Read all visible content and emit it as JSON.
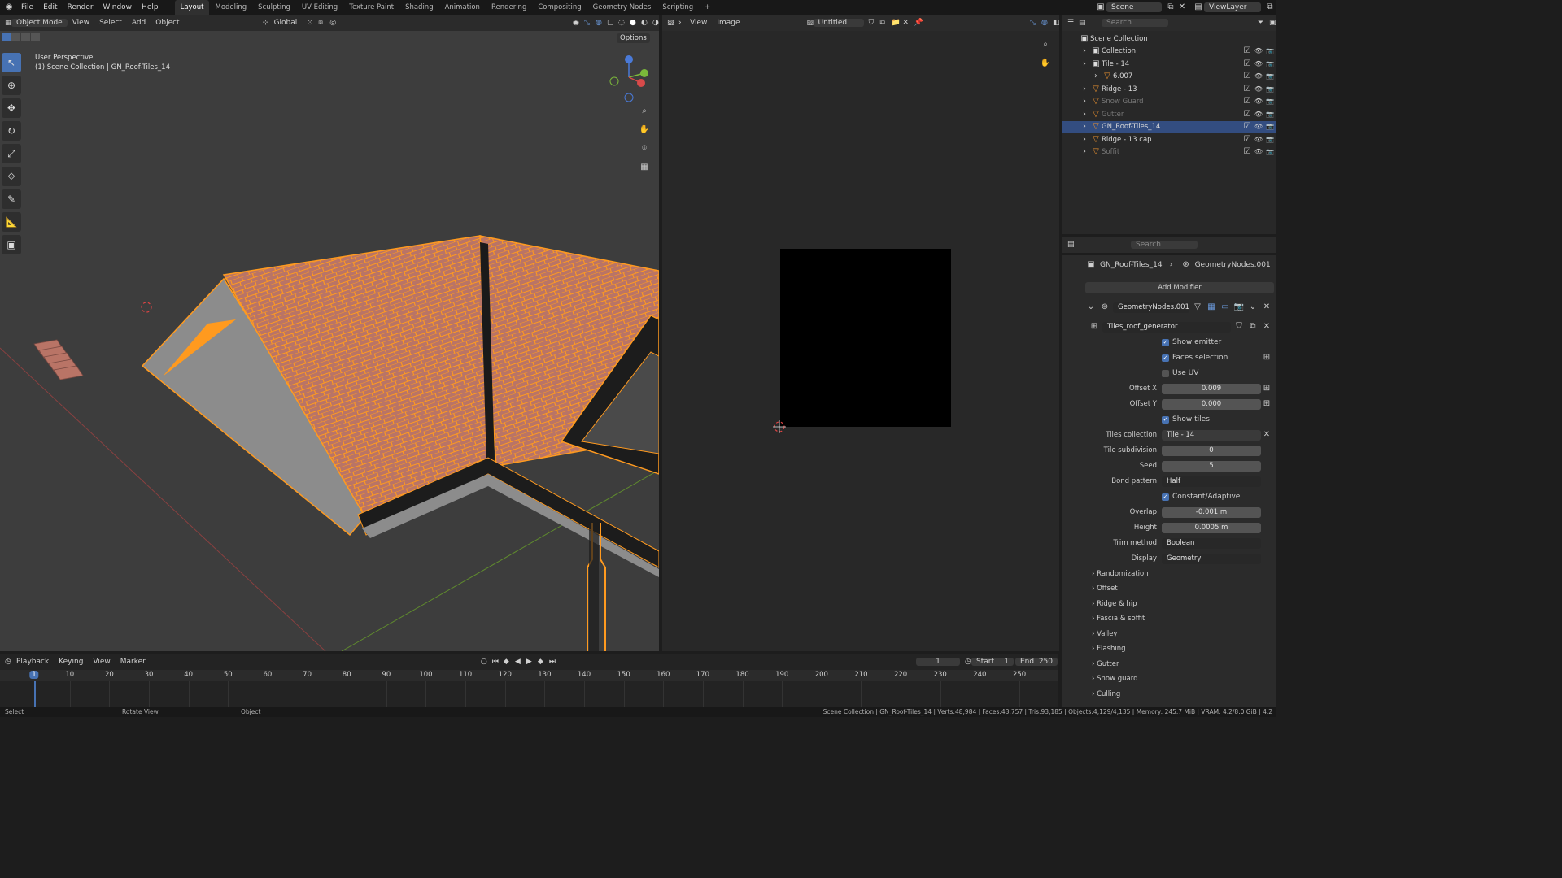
{
  "topbar": {
    "menus": [
      "File",
      "Edit",
      "Render",
      "Window",
      "Help"
    ],
    "workspaces": [
      "Layout",
      "Modeling",
      "Sculpting",
      "UV Editing",
      "Texture Paint",
      "Shading",
      "Animation",
      "Rendering",
      "Compositing",
      "Geometry Nodes",
      "Scripting"
    ],
    "active_workspace": "Layout",
    "scene": "Scene",
    "view_layer": "ViewLayer"
  },
  "viewport": {
    "mode": "Object Mode",
    "menus": [
      "View",
      "Select",
      "Add",
      "Object"
    ],
    "orientation": "Global",
    "options": "Options",
    "perspective": "User Perspective",
    "context": "(1) Scene Collection | GN_Roof-Tiles_14"
  },
  "image_editor": {
    "menus": [
      "View",
      "Image"
    ],
    "image_name": "Untitled"
  },
  "outliner": {
    "search_placeholder": "Search",
    "rows": [
      {
        "label": "Scene Collection",
        "indent": 0,
        "dim": false,
        "sel": false
      },
      {
        "label": "Collection",
        "indent": 1,
        "dim": false,
        "sel": false
      },
      {
        "label": "Tile - 14",
        "indent": 1,
        "dim": false,
        "sel": false
      },
      {
        "label": "6.007",
        "indent": 2,
        "dim": false,
        "sel": false
      },
      {
        "label": "Ridge - 13",
        "indent": 1,
        "dim": false,
        "sel": false
      },
      {
        "label": "Snow Guard",
        "indent": 1,
        "dim": true,
        "sel": false
      },
      {
        "label": "Gutter",
        "indent": 1,
        "dim": true,
        "sel": false
      },
      {
        "label": "GN_Roof-Tiles_14",
        "indent": 1,
        "dim": false,
        "sel": true
      },
      {
        "label": "Ridge - 13 cap",
        "indent": 1,
        "dim": false,
        "sel": false
      },
      {
        "label": "Soffit",
        "indent": 1,
        "dim": true,
        "sel": false
      }
    ]
  },
  "properties": {
    "search_placeholder": "Search",
    "breadcrumb_object": "GN_Roof-Tiles_14",
    "breadcrumb_modifier": "GeometryNodes.001",
    "add_modifier": "Add Modifier",
    "modifier_name": "GeometryNodes.001",
    "node_group": "Tiles_roof_generator",
    "show_emitter": "Show emitter",
    "faces_selection": "Faces selection",
    "use_uv": "Use UV",
    "offset_x_label": "Offset X",
    "offset_x": "0.009",
    "offset_y_label": "Offset Y",
    "offset_y": "0.000",
    "show_tiles": "Show tiles",
    "tiles_collection_label": "Tiles collection",
    "tiles_collection": "Tile - 14",
    "tile_subdivision_label": "Tile subdivision",
    "tile_subdivision": "0",
    "seed_label": "Seed",
    "seed": "5",
    "bond_pattern_label": "Bond pattern",
    "bond_pattern": "Half",
    "constant_adaptive": "Constant/Adaptive",
    "overlap_label": "Overlap",
    "overlap": "-0.001 m",
    "height_label": "Height",
    "height": "0.0005 m",
    "trim_method_label": "Trim method",
    "trim_method": "Boolean",
    "display_label": "Display",
    "display": "Geometry",
    "panels": [
      "Randomization",
      "Offset",
      "Ridge & hip",
      "Fascia & soffit",
      "Valley",
      "Flashing",
      "Gutter",
      "Snow guard",
      "Culling"
    ]
  },
  "timeline": {
    "menus": [
      "Playback",
      "Keying",
      "View",
      "Marker"
    ],
    "current_frame": "1",
    "start_label": "Start",
    "start": "1",
    "end_label": "End",
    "end": "250",
    "ticks": [
      "1",
      "10",
      "20",
      "30",
      "40",
      "50",
      "60",
      "70",
      "80",
      "90",
      "100",
      "110",
      "120",
      "130",
      "140",
      "150",
      "160",
      "170",
      "180",
      "190",
      "200",
      "210",
      "220",
      "230",
      "240",
      "250"
    ]
  },
  "statusbar": {
    "select": "Select",
    "rotate": "Rotate View",
    "object": "Object",
    "stats": "Scene Collection | GN_Roof-Tiles_14 | Verts:48,984 | Faces:43,757 | Tris:93,185 | Objects:4,129/4,135 | Memory: 245.7 MiB | VRAM: 4.2/8.0 GiB | 4.2"
  },
  "colors": {
    "accent": "#4772b3",
    "selection": "#ff9a1f",
    "tile": "#b97466",
    "roof_bg": "#3d3d3d"
  }
}
